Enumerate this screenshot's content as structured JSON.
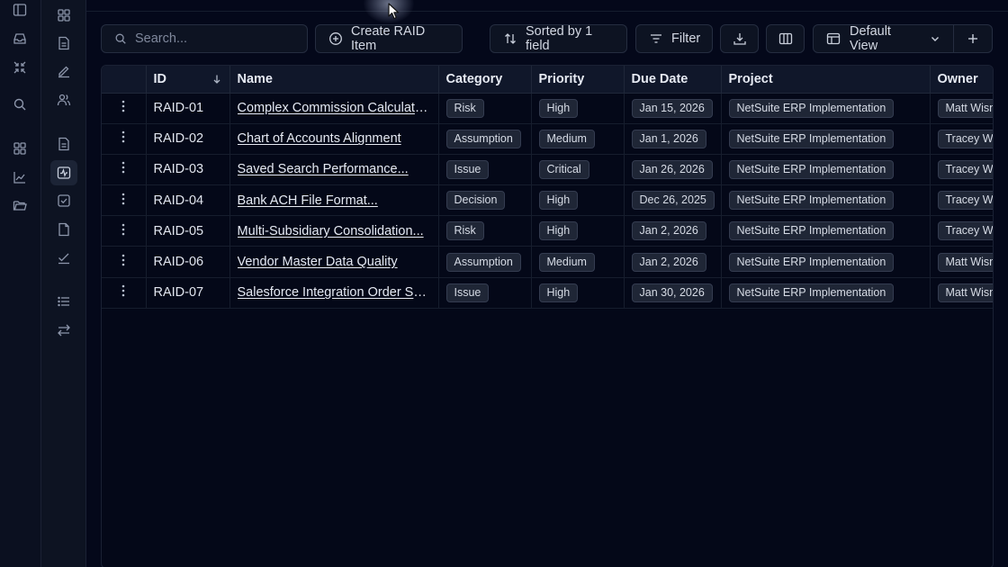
{
  "toolbar": {
    "search_placeholder": "Search...",
    "create_label": "Create RAID Item",
    "sort_label": "Sorted by 1 field",
    "filter_label": "Filter",
    "view_label": "Default View"
  },
  "table": {
    "columns": {
      "id": "ID",
      "name": "Name",
      "category": "Category",
      "priority": "Priority",
      "due_date": "Due Date",
      "project": "Project",
      "owner": "Owner"
    },
    "rows": [
      {
        "id": "RAID-01",
        "name": "Complex Commission Calculation...",
        "category": "Risk",
        "priority": "High",
        "due_date": "Jan 15, 2026",
        "project": "NetSuite ERP Implementation",
        "owner": "Matt Wisn"
      },
      {
        "id": "RAID-02",
        "name": "Chart of Accounts Alignment",
        "category": "Assumption",
        "priority": "Medium",
        "due_date": "Jan 1, 2026",
        "project": "NetSuite ERP Implementation",
        "owner": "Tracey Wi"
      },
      {
        "id": "RAID-03",
        "name": "Saved Search Performance...",
        "category": "Issue",
        "priority": "Critical",
        "due_date": "Jan 26, 2026",
        "project": "NetSuite ERP Implementation",
        "owner": "Tracey Wi"
      },
      {
        "id": "RAID-04",
        "name": "Bank ACH File Format...",
        "category": "Decision",
        "priority": "High",
        "due_date": "Dec 26, 2025",
        "project": "NetSuite ERP Implementation",
        "owner": "Tracey Wi"
      },
      {
        "id": "RAID-05",
        "name": "Multi-Subsidiary Consolidation...",
        "category": "Risk",
        "priority": "High",
        "due_date": "Jan 2, 2026",
        "project": "NetSuite ERP Implementation",
        "owner": "Tracey Wi"
      },
      {
        "id": "RAID-06",
        "name": "Vendor Master Data Quality",
        "category": "Assumption",
        "priority": "Medium",
        "due_date": "Jan 2, 2026",
        "project": "NetSuite ERP Implementation",
        "owner": "Matt Wisn"
      },
      {
        "id": "RAID-07",
        "name": "Salesforce Integration Order Syn...",
        "category": "Issue",
        "priority": "High",
        "due_date": "Jan 30, 2026",
        "project": "NetSuite ERP Implementation",
        "owner": "Matt Wisn"
      }
    ]
  },
  "icons": {
    "rail_primary": [
      "sidebar-toggle-icon",
      "inbox-icon",
      "collapse-icon",
      "search-icon"
    ],
    "rail_secondary": [
      "dashboard-icon",
      "document-icon",
      "edit-icon",
      "users-icon",
      "apps-icon",
      "document-icon",
      "activity-icon",
      "checkbox-icon",
      "file-icon",
      "chart-line-icon",
      "checkmark-icon",
      "list-icon",
      "swap-icon"
    ]
  },
  "colors": {
    "background": "#04081a",
    "rail": "#0b1020",
    "pill_bg": "#1f2636",
    "text": "#e4e8f2"
  }
}
